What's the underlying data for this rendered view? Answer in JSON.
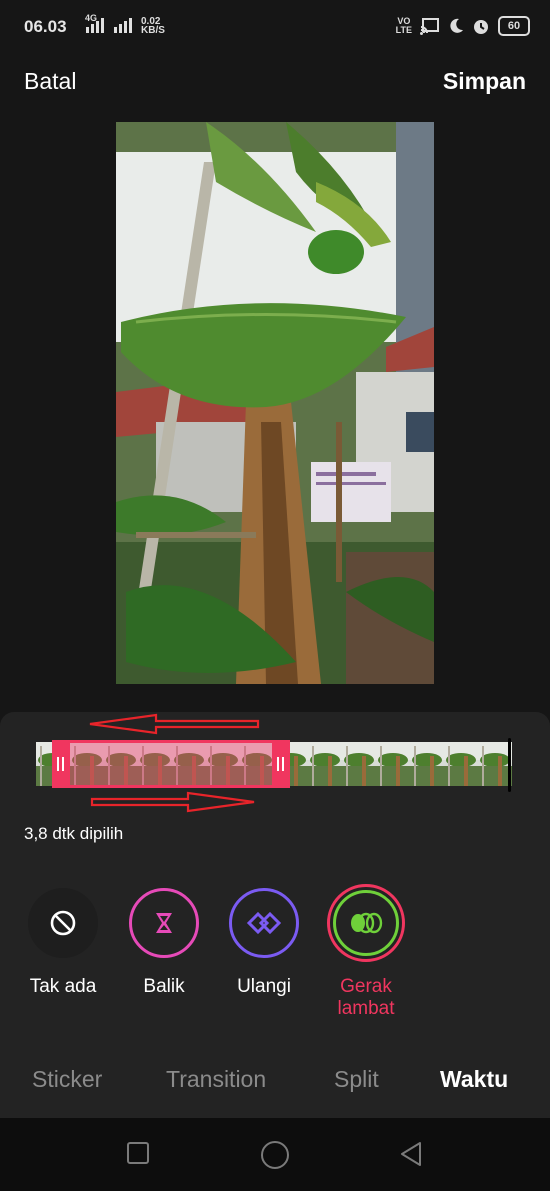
{
  "status_bar": {
    "time": "06.03",
    "network_type": "4G",
    "speed_value": "0.02",
    "speed_unit": "KB/S",
    "volte_top": "VO",
    "volte_bottom": "LTE",
    "battery": "60",
    "icons": [
      "signal-icon",
      "cast-icon",
      "moon-icon",
      "alarm-icon",
      "battery-icon"
    ]
  },
  "header": {
    "cancel_label": "Batal",
    "save_label": "Simpan"
  },
  "timeline": {
    "selected_duration": "3,8 dtk dipilih",
    "selection_color": "#f0365f"
  },
  "effects": [
    {
      "label": "Tak ada",
      "icon": "no-effect-icon",
      "ring_color": "none"
    },
    {
      "label": "Balik",
      "icon": "reverse-hourglass-icon",
      "ring_color": "#e64ab8"
    },
    {
      "label": "Ulangi",
      "icon": "repeat-diamond-icon",
      "ring_color": "#7b5bf2"
    },
    {
      "label": "Gerak lambat",
      "icon": "slow-motion-icon",
      "ring_color": "#f0365f",
      "active": true
    }
  ],
  "tabs": [
    {
      "label": "Sticker"
    },
    {
      "label": "Transition"
    },
    {
      "label": "Split"
    },
    {
      "label": "Waktu",
      "active": true
    }
  ],
  "nav": [
    "recent-apps-icon",
    "home-icon",
    "back-icon"
  ]
}
